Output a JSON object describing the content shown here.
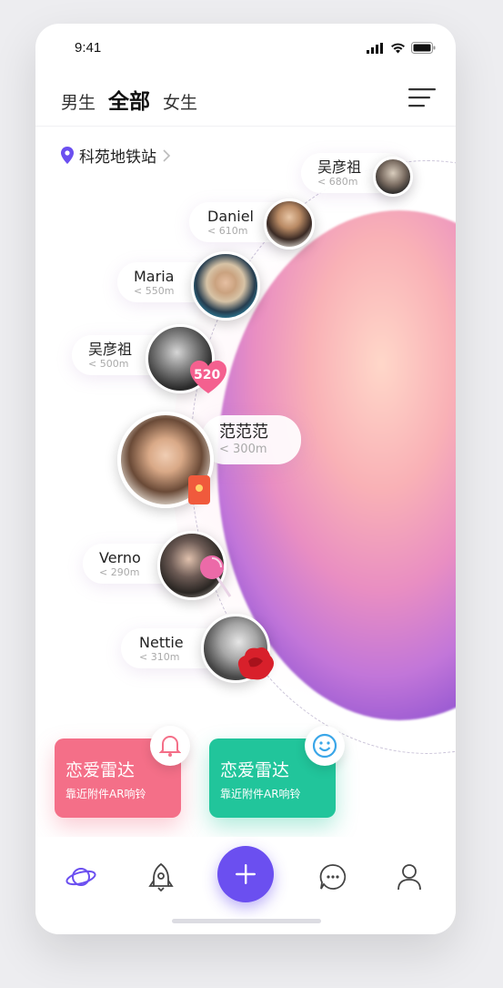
{
  "status": {
    "time": "9:41"
  },
  "tabs": [
    {
      "label": "男生"
    },
    {
      "label": "全部"
    },
    {
      "label": "女生"
    }
  ],
  "location": {
    "name": "科苑地铁站"
  },
  "users": [
    {
      "name": "吴彦祖",
      "distance": "< 680m"
    },
    {
      "name": "Daniel",
      "distance": "< 610m"
    },
    {
      "name": "Maria",
      "distance": "< 550m"
    },
    {
      "name": "吴彦祖",
      "distance": "< 500m",
      "badge": "520"
    },
    {
      "name": "范范范",
      "distance": "< 300m"
    },
    {
      "name": "Verno",
      "distance": "< 290m"
    },
    {
      "name": "Nettie",
      "distance": "< 310m"
    }
  ],
  "cards": [
    {
      "title": "恋爱雷达",
      "subtitle": "靠近附件AR响铃",
      "color": "#f46f88"
    },
    {
      "title": "恋爱雷达",
      "subtitle": "靠近附件AR响铃",
      "color": "#21c59b"
    }
  ],
  "colors": {
    "accent": "#6b4ff0"
  },
  "nav": {
    "items": [
      "planet-icon",
      "rocket-icon",
      "plus-icon",
      "chat-icon",
      "profile-icon"
    ]
  }
}
